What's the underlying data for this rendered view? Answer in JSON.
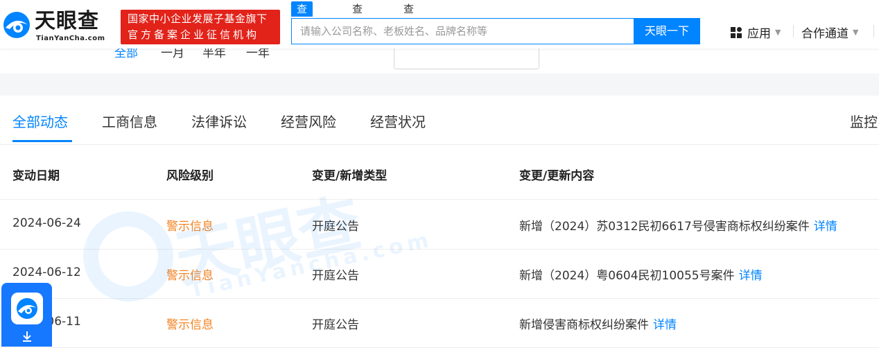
{
  "header": {
    "logo_cn": "天眼查",
    "logo_en": "TianYanCha.com",
    "badge_line1": "国家中小企业发展子基金旗下",
    "badge_line2": "官方备案企业征信机构",
    "search_tabs": [
      "查公司",
      "查老板",
      "查关系"
    ],
    "search_placeholder": "请输入公司名称、老板姓名、品牌名称等",
    "search_button": "天眼一下",
    "nav_apps": "应用",
    "nav_coop": "合作通道"
  },
  "filters": {
    "items": [
      "全部",
      "一月",
      "半年",
      "一年"
    ]
  },
  "tabs": {
    "items": [
      "全部动态",
      "工商信息",
      "法律诉讼",
      "经营风险",
      "经营状况"
    ],
    "monitor": "监控"
  },
  "table": {
    "headers": [
      "变动日期",
      "风险级别",
      "变更/新增类型",
      "变更/更新内容"
    ],
    "rows": [
      {
        "date": "2024-06-24",
        "risk": "警示信息",
        "type": "开庭公告",
        "content": "新增（2024）苏0312民初6617号侵害商标权纠纷案件",
        "link": "详情"
      },
      {
        "date": "2024-06-12",
        "risk": "警示信息",
        "type": "开庭公告",
        "content": "新增（2024）粤0604民初10055号案件",
        "link": "详情"
      },
      {
        "date": "2024-06-11",
        "risk": "警示信息",
        "type": "开庭公告",
        "content": "新增侵害商标权纠纷案件",
        "link": "详情"
      }
    ]
  },
  "watermark": {
    "cn": "天眼查",
    "en": "TianYancha.com"
  },
  "colors": {
    "accent": "#0084ff",
    "badge_red": "#e2231a",
    "risk_orange": "#f48322"
  }
}
